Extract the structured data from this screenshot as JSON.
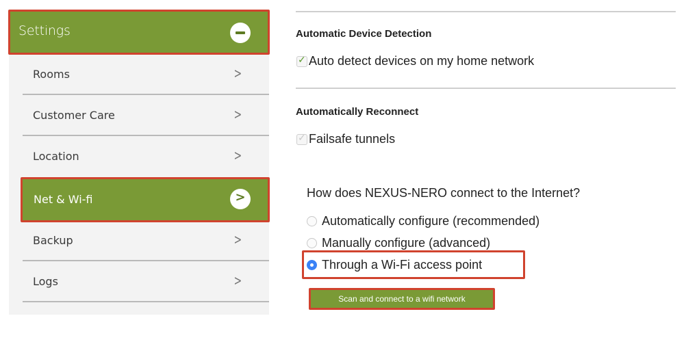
{
  "sidebar": {
    "header": {
      "title": "Settings",
      "icon": "minus-circle-icon"
    },
    "items": [
      {
        "label": "Rooms",
        "icon": "chevron-right-icon"
      },
      {
        "label": "Customer Care",
        "icon": "chevron-right-icon"
      },
      {
        "label": "Location",
        "icon": "chevron-right-icon"
      },
      {
        "label": "Net & Wi-fi",
        "icon": "chevron-right-circle-icon",
        "active": true
      },
      {
        "label": "Backup",
        "icon": "chevron-right-icon"
      },
      {
        "label": "Logs",
        "icon": "chevron-right-icon"
      }
    ],
    "chevron_glyph": ">"
  },
  "main": {
    "device_detection": {
      "title": "Automatic Device Detection",
      "option": {
        "label": "Auto detect devices on my home network",
        "checked": true
      }
    },
    "reconnect": {
      "title": "Automatically Reconnect",
      "option": {
        "label": "Failsafe tunnels",
        "checked": true,
        "disabled": true
      }
    },
    "connection": {
      "question": "How does NEXUS-NERO connect to the Internet?",
      "options": [
        {
          "label": "Automatically configure (recommended)",
          "selected": false
        },
        {
          "label": "Manually configure (advanced)",
          "selected": false
        },
        {
          "label": "Through a Wi-Fi access point",
          "selected": true
        }
      ]
    },
    "scan_button": "Scan and connect to a wifi network"
  },
  "colors": {
    "accent_green": "#7a9a36",
    "highlight_red": "#d0432e",
    "radio_blue": "#3b82f6"
  }
}
